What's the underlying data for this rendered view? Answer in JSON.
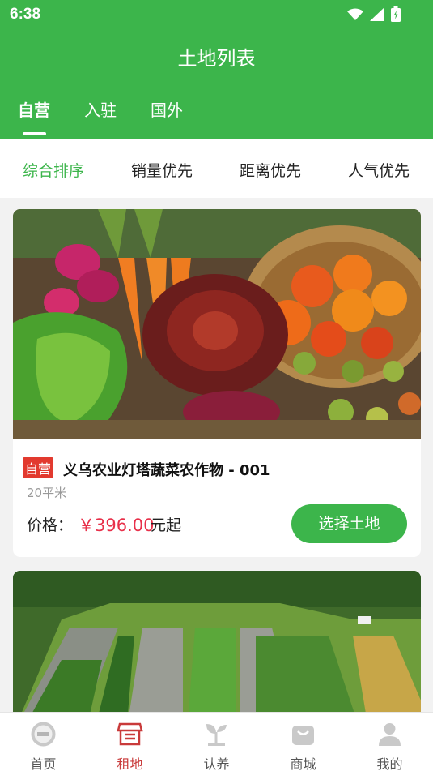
{
  "status_bar": {
    "time": "6:38"
  },
  "header": {
    "title": "土地列表"
  },
  "tabs": [
    {
      "label": "自营",
      "active": true
    },
    {
      "label": "入驻",
      "active": false
    },
    {
      "label": "国外",
      "active": false
    }
  ],
  "sort": [
    {
      "label": "综合排序",
      "active": true
    },
    {
      "label": "销量优先",
      "active": false
    },
    {
      "label": "距离优先",
      "active": false
    },
    {
      "label": "人气优先",
      "active": false
    }
  ],
  "listings": [
    {
      "image_subject": "vegetables-photo",
      "badge": "自营",
      "name": "义乌农业灯塔蔬菜农作物 - 001",
      "area": "20平米",
      "price_label": "价格：",
      "price": "￥396.00",
      "price_suffix": "元起",
      "button": "选择土地"
    },
    {
      "image_subject": "garden-beds-photo"
    }
  ],
  "bottom_nav": [
    {
      "label": "首页",
      "icon": "home-emblem-icon",
      "active": false
    },
    {
      "label": "租地",
      "icon": "store-icon",
      "active": true
    },
    {
      "label": "认养",
      "icon": "sprout-icon",
      "active": false
    },
    {
      "label": "商城",
      "icon": "mall-icon",
      "active": false
    },
    {
      "label": "我的",
      "icon": "user-icon",
      "active": false
    }
  ],
  "colors": {
    "brand_green": "#3cb54b",
    "price_red": "#e8304a",
    "badge_red": "#e23a2f",
    "nav_active": "#c93a3a"
  }
}
